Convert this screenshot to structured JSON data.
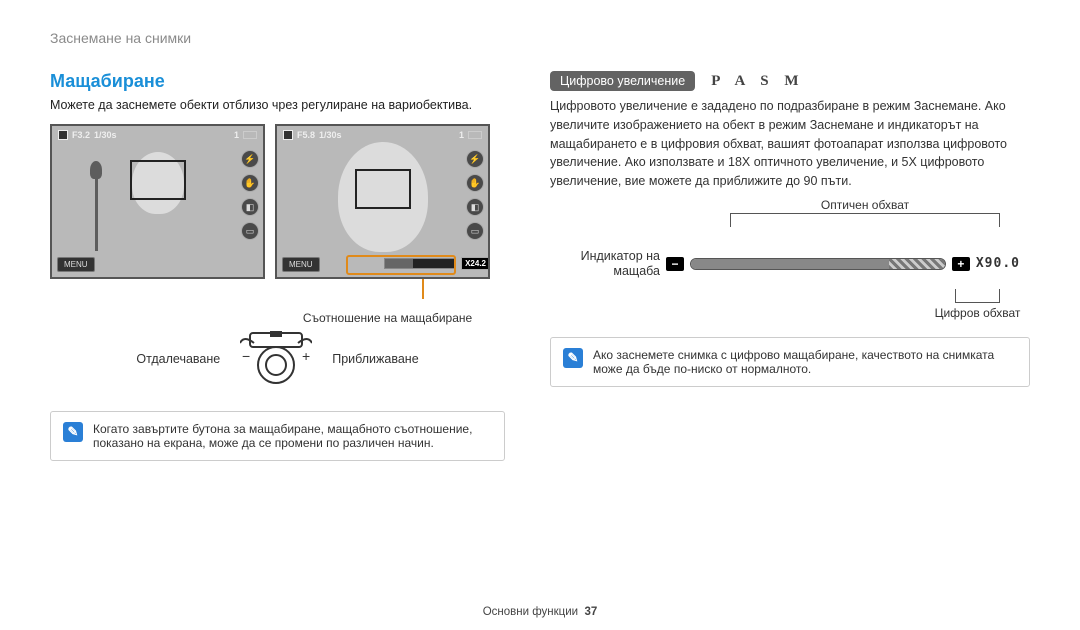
{
  "breadcrumb": "Заснемане на снимки",
  "left": {
    "heading": "Мащабиране",
    "intro": "Можете да заснемете обекти отблизо чрез регулиране на вариобектива.",
    "screen1": {
      "aperture": "F3.2",
      "shutter": "1/30s",
      "count": "1",
      "menu": "MENU",
      "zoom_label": ""
    },
    "screen2": {
      "aperture": "F5.8",
      "shutter": "1/30s",
      "count": "1",
      "menu": "MENU",
      "zoom_label": "X24.2"
    },
    "ratio_label": "Съотношение на мащабиране",
    "zoom_out": "Отдалечаване",
    "zoom_in": "Приближаване",
    "note": "Когато завъртите бутона за мащабиране, мащабното съотношение, показано на екрана, може да се промени по различен начин."
  },
  "right": {
    "pill": "Цифрово увеличение",
    "pasm": "P A S M",
    "body": "Цифровото увеличение е зададено по подразбиране в режим Заснемане. Ако увеличите изображението на обект в режим Заснемане и индикаторът на мащабирането е в цифровия обхват, вашият фотоапарат използва цифровото увеличение. Ако използвате и 18X оптичното увеличение, и 5X цифровото увеличение, вие можете да приближите до 90 пъти.",
    "optical_label": "Оптичен обхват",
    "scale_label": "Индикатор на мащаба",
    "digital_label": "Цифров обхват",
    "x_value": "X90.0",
    "note": "Ако заснемете снимка с цифрово мащабиране, качеството на снимката може да бъде по-ниско от нормалното."
  },
  "footer": {
    "section": "Основни функции",
    "page": "37"
  }
}
